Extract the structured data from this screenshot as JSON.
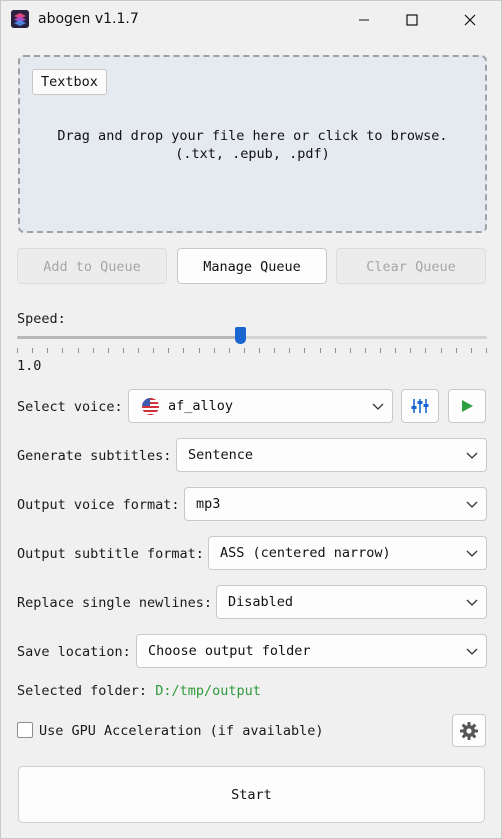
{
  "window": {
    "title": "abogen v1.1.7"
  },
  "dropzone": {
    "textbox_label": "Textbox",
    "line1": "Drag and drop your file here or click to browse.",
    "line2": "(.txt, .epub, .pdf)"
  },
  "queue": {
    "add_label": "Add to Queue",
    "manage_label": "Manage Queue",
    "clear_label": "Clear Queue"
  },
  "speed": {
    "label": "Speed:",
    "value_text": "1.0",
    "fraction": 0.475
  },
  "voice": {
    "label": "Select voice:",
    "value": "af_alloy",
    "flag_icon": "us-flag-icon"
  },
  "subtitles": {
    "label": "Generate subtitles:",
    "value": "Sentence"
  },
  "voice_format": {
    "label": "Output voice format:",
    "value": "mp3"
  },
  "subtitle_format": {
    "label": "Output subtitle format:",
    "value": "ASS (centered narrow)"
  },
  "newlines": {
    "label": "Replace single newlines:",
    "value": "Disabled"
  },
  "save_location": {
    "label": "Save location:",
    "value": "Choose output folder"
  },
  "selected_folder": {
    "label": "Selected folder:",
    "path": "D:/tmp/output"
  },
  "gpu": {
    "label": "Use GPU Acceleration (if available)",
    "checked": false
  },
  "start": {
    "label": "Start"
  },
  "colors": {
    "accent": "#1a66d1",
    "play": "#2ea043",
    "folder_path": "#2e9a3b"
  }
}
